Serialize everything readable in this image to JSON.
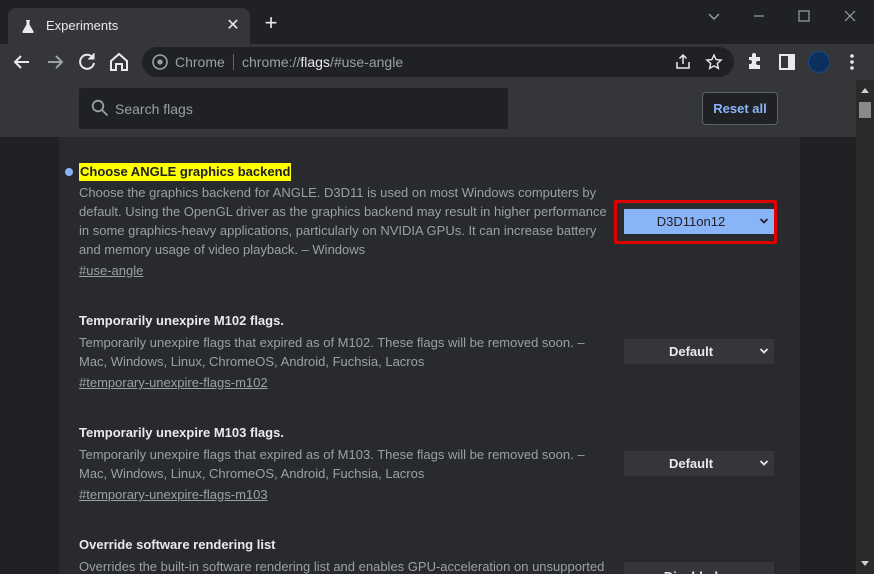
{
  "tab": {
    "title": "Experiments"
  },
  "omnibox": {
    "chip": "Chrome",
    "scheme": "chrome://",
    "host": "flags",
    "path": "/#use-angle"
  },
  "search": {
    "placeholder": "Search flags"
  },
  "reset_label": "Reset all",
  "flags": [
    {
      "title": "Choose ANGLE graphics backend",
      "desc": "Choose the graphics backend for ANGLE. D3D11 is used on most Windows computers by default. Using the OpenGL driver as the graphics backend may result in higher performance in some graphics-heavy applications, particularly on NVIDIA GPUs. It can increase battery and memory usage of video playback. – Windows",
      "link": "#use-angle",
      "value": "D3D11on12"
    },
    {
      "title": "Temporarily unexpire M102 flags.",
      "desc": "Temporarily unexpire flags that expired as of M102. These flags will be removed soon. – Mac, Windows, Linux, ChromeOS, Android, Fuchsia, Lacros",
      "link": "#temporary-unexpire-flags-m102",
      "value": "Default"
    },
    {
      "title": "Temporarily unexpire M103 flags.",
      "desc": "Temporarily unexpire flags that expired as of M103. These flags will be removed soon. – Mac, Windows, Linux, ChromeOS, Android, Fuchsia, Lacros",
      "link": "#temporary-unexpire-flags-m103",
      "value": "Default"
    },
    {
      "title": "Override software rendering list",
      "desc": "Overrides the built-in software rendering list and enables GPU-acceleration on unsupported",
      "value": "Disabled"
    }
  ],
  "colors": {
    "accent": "#8ab4f8",
    "highlight": "#ffff00",
    "callout": "#e00000"
  }
}
